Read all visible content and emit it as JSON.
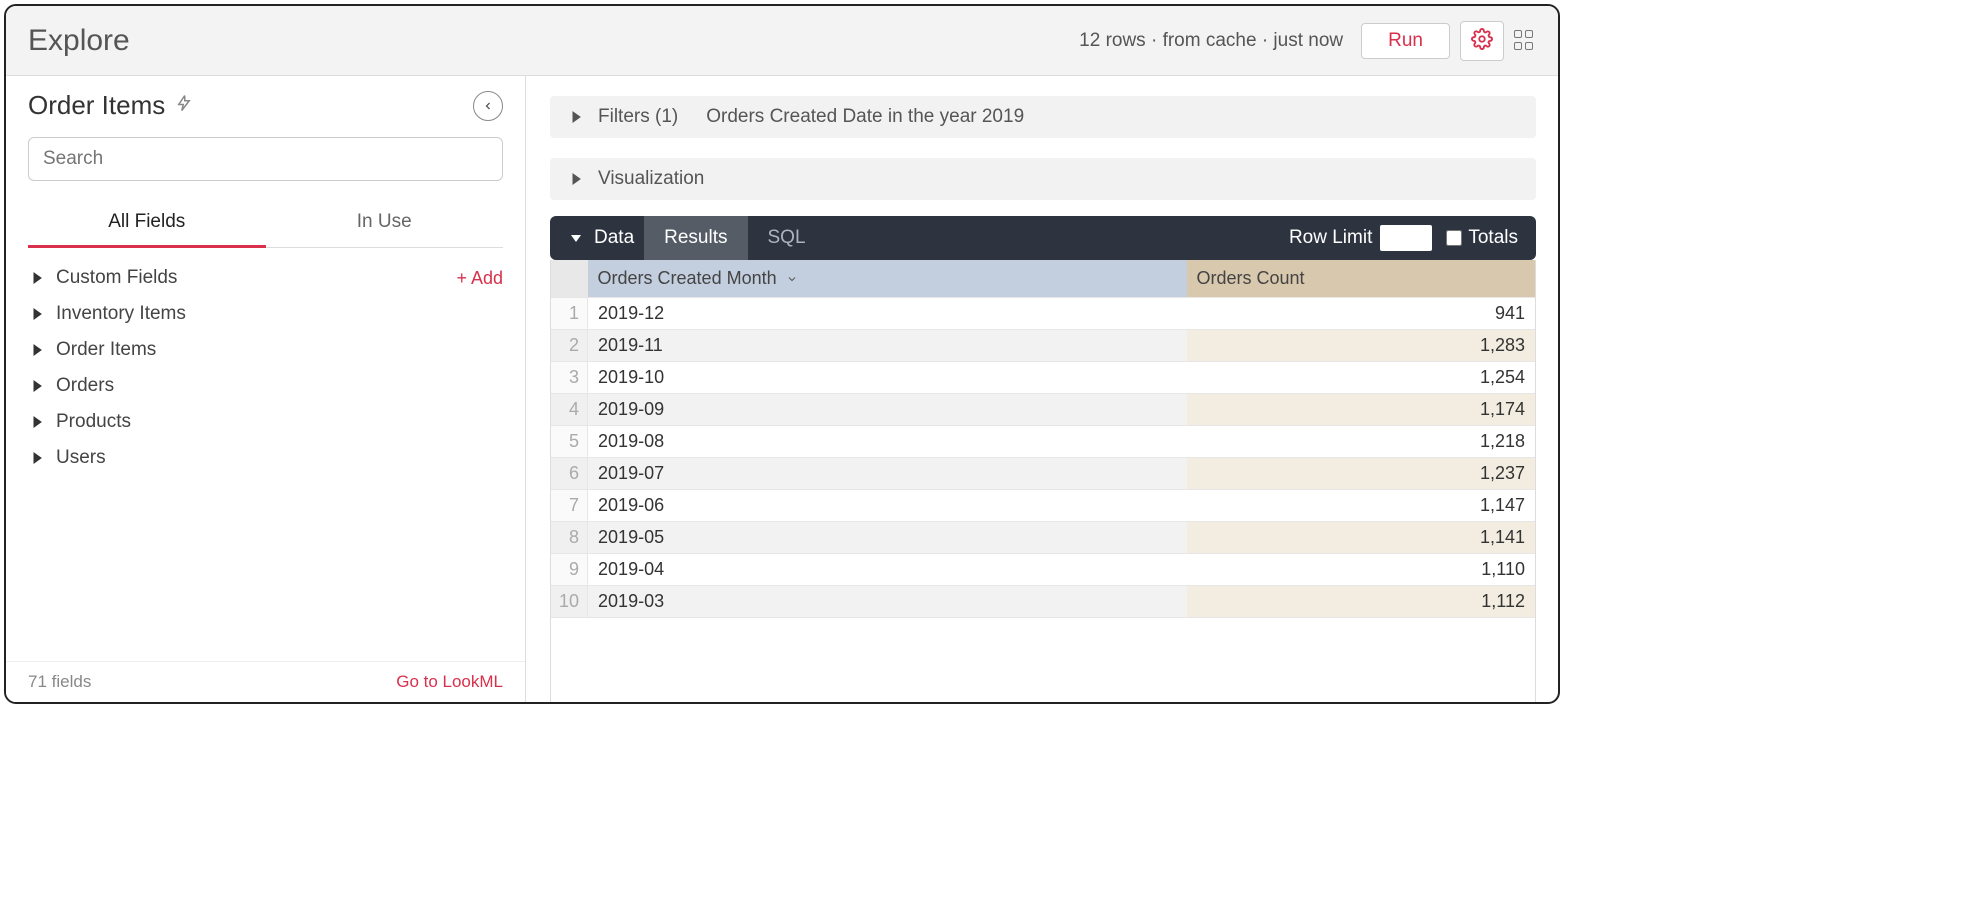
{
  "topbar": {
    "title": "Explore",
    "status": "12 rows  ·  from cache  ·  just now",
    "run_label": "Run"
  },
  "sidebar": {
    "title": "Order Items",
    "search_placeholder": "Search",
    "tabs": {
      "all": "All Fields",
      "in_use": "In Use"
    },
    "add_label": "+  Add",
    "groups": [
      "Custom Fields",
      "Inventory Items",
      "Order Items",
      "Orders",
      "Products",
      "Users"
    ],
    "footer_count": "71 fields",
    "footer_link": "Go to LookML"
  },
  "panels": {
    "filters_label": "Filters (1)",
    "filters_desc": "Orders Created Date in the year 2019",
    "viz_label": "Visualization"
  },
  "databar": {
    "data_label": "Data",
    "results_label": "Results",
    "sql_label": "SQL",
    "row_limit_label": "Row Limit",
    "totals_label": "Totals"
  },
  "table": {
    "dim_header": "Orders Created Month",
    "meas_header": "Orders Count",
    "rows": [
      {
        "n": "1",
        "month": "2019-12",
        "count": "941"
      },
      {
        "n": "2",
        "month": "2019-11",
        "count": "1,283"
      },
      {
        "n": "3",
        "month": "2019-10",
        "count": "1,254"
      },
      {
        "n": "4",
        "month": "2019-09",
        "count": "1,174"
      },
      {
        "n": "5",
        "month": "2019-08",
        "count": "1,218"
      },
      {
        "n": "6",
        "month": "2019-07",
        "count": "1,237"
      },
      {
        "n": "7",
        "month": "2019-06",
        "count": "1,147"
      },
      {
        "n": "8",
        "month": "2019-05",
        "count": "1,141"
      },
      {
        "n": "9",
        "month": "2019-04",
        "count": "1,110"
      },
      {
        "n": "10",
        "month": "2019-03",
        "count": "1,112"
      }
    ]
  }
}
